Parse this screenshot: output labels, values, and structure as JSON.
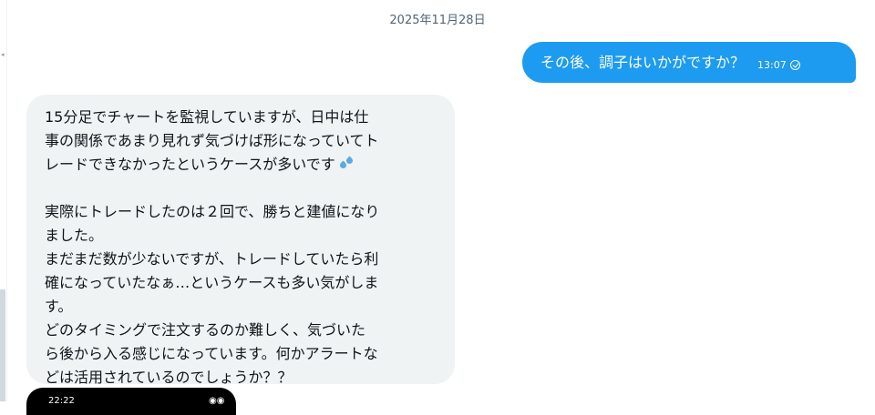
{
  "date_separator": "2025年11月28日",
  "sent_message": {
    "text": "その後、調子はいかがですか？",
    "time": "13:07",
    "status_icon": "check-circle-icon",
    "color": "#1d9bf0"
  },
  "received_message": {
    "lines": [
      "15分足でチャートを監視していますが、日中は仕",
      "事の関係であまり見れず気づけば形になっていてト",
      "レードできなかったというケースが多いです",
      "",
      "実際にトレードしたのは２回で、勝ちと建値になり",
      "ました。",
      "まだまだ数が少ないですが、トレードしていたら利",
      "確になっていたなぁ…というケースも多い気がしま",
      "す。",
      "どのタイミングで注文するのか難しく、気づいた",
      "ら後から入る感じになっています。何かアラートな",
      "どは活用されているのでしょうか？？"
    ],
    "emoji": "sweat-droplets-icon",
    "color": "#eff3f4"
  },
  "next_message_peek": {
    "left_text": "22:22",
    "right_text": "◉◉"
  }
}
